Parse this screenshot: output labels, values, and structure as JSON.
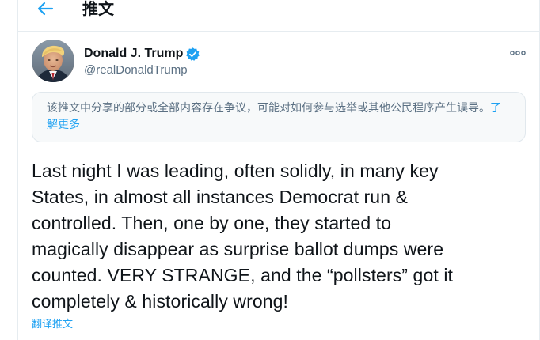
{
  "header": {
    "title": "推文"
  },
  "author": {
    "name": "Donald J. Trump",
    "handle": "@realDonaldTrump"
  },
  "notice": {
    "text": "该推文中分享的部分或全部内容存在争议，可能对如何参与选举或其他公民程序产生误导。",
    "link": "了解更多"
  },
  "tweet": {
    "lines": [
      "Last night I was leading, often solidly, in many key",
      "States, in almost all instances Democrat run &",
      "controlled. Then, one by one, they started to",
      "magically disappear as surprise ballot dumps were",
      "counted. VERY STRANGE, and the “pollsters” got it",
      "completely & historically wrong!"
    ]
  },
  "actions": {
    "translate": "翻译推文"
  },
  "colors": {
    "accent": "#1da1f2",
    "text": "#0f1419",
    "secondary": "#5b7083",
    "notice_bg": "#f7f9fa",
    "border": "#e6ecf0"
  },
  "icons": {
    "back": "arrow-left-icon",
    "verified": "verified-badge-icon",
    "more": "more-horizontal-icon"
  }
}
